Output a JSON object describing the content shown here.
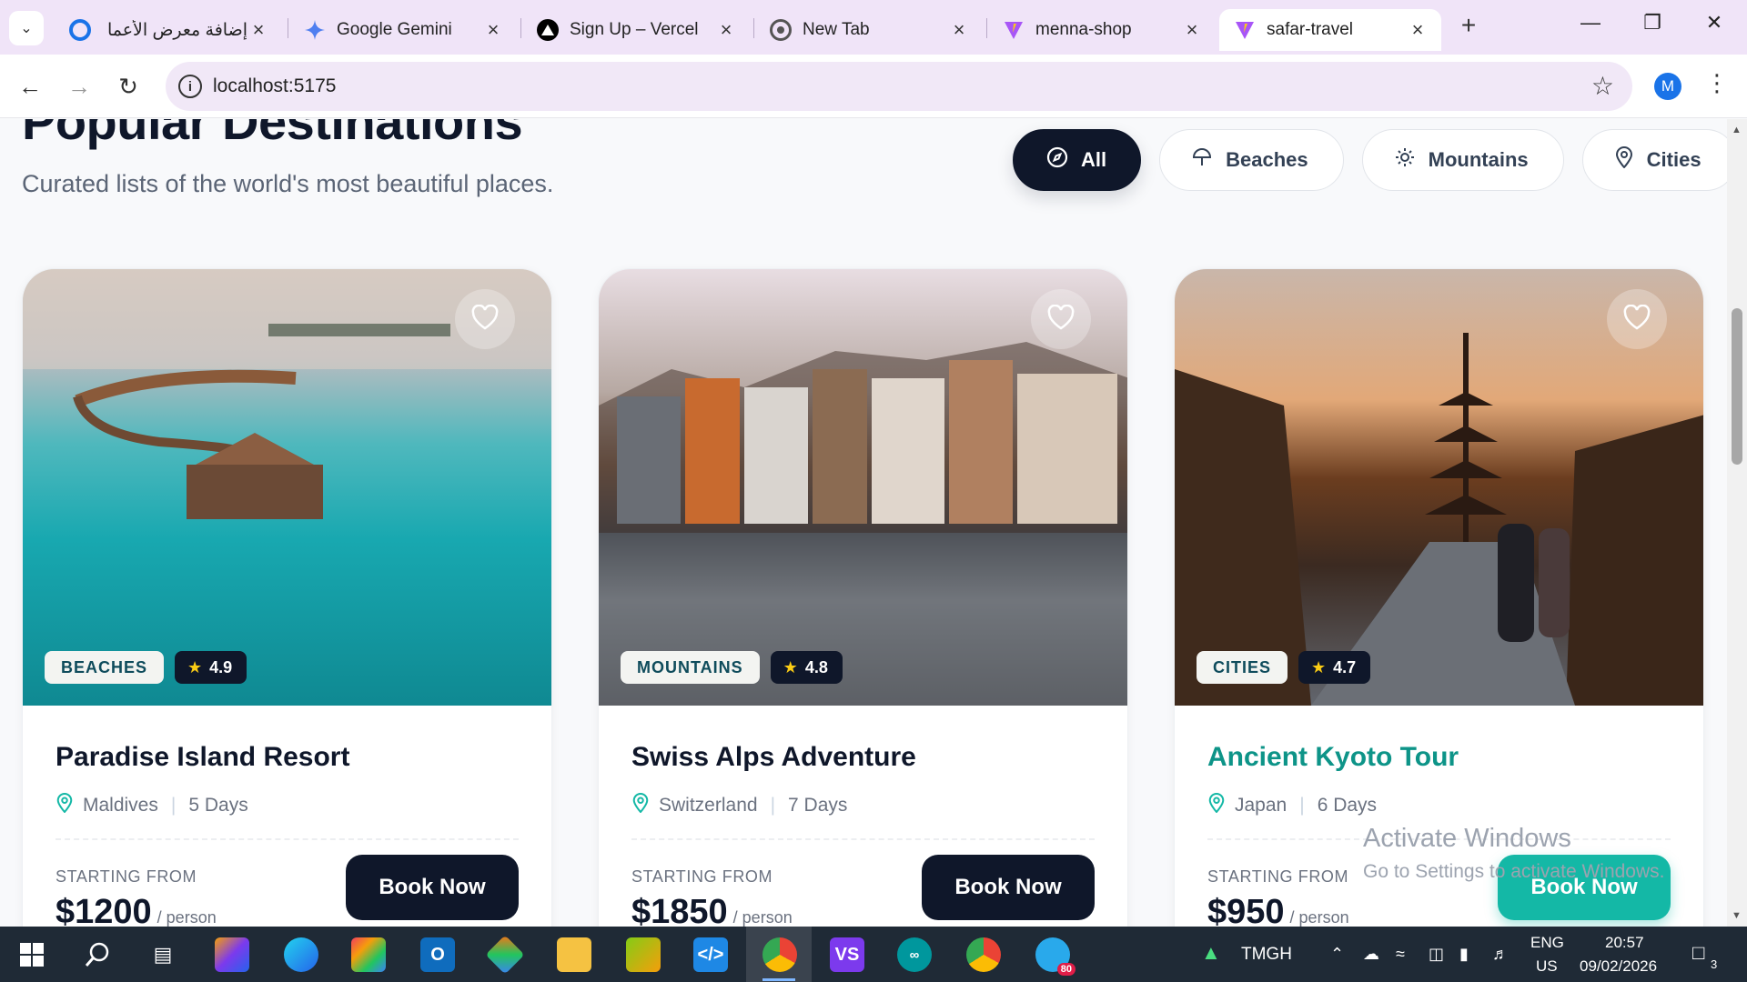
{
  "browser": {
    "tabs": [
      {
        "title": "إضافة معرض الأعما",
        "favicon": "web-icon",
        "favicon_color": "#1a73e8",
        "active": false
      },
      {
        "title": "Google Gemini",
        "favicon": "gemini-icon",
        "favicon_color": "#5b8def",
        "active": false
      },
      {
        "title": "Sign Up – Vercel",
        "favicon": "vercel-icon",
        "favicon_color": "#000000",
        "active": false
      },
      {
        "title": "New Tab",
        "favicon": "chrome-icon",
        "favicon_color": "#555555",
        "active": false
      },
      {
        "title": "menna-shop",
        "favicon": "vite-icon",
        "favicon_color": "#a855f7",
        "active": false
      },
      {
        "title": "safar-travel",
        "favicon": "vite-icon",
        "favicon_color": "#a855f7",
        "active": true
      }
    ],
    "url": "localhost:5175",
    "profile_initial": "M"
  },
  "page": {
    "title": "Popular Destinations",
    "subtitle": "Curated lists of the world's most beautiful places.",
    "filters": [
      {
        "label": "All",
        "icon": "compass-icon",
        "active": true
      },
      {
        "label": "Beaches",
        "icon": "umbrella-icon",
        "active": false
      },
      {
        "label": "Mountains",
        "icon": "sun-icon",
        "active": false
      },
      {
        "label": "Cities",
        "icon": "map-pin-icon",
        "active": false
      }
    ],
    "cards": [
      {
        "title": "Paradise Island Resort",
        "category": "BEACHES",
        "rating": "4.9",
        "location": "Maldives",
        "duration": "5 Days",
        "from_label": "STARTING FROM",
        "price": "$1200",
        "per": "/ person",
        "button": "Book Now"
      },
      {
        "title": "Swiss Alps Adventure",
        "category": "MOUNTAINS",
        "rating": "4.8",
        "location": "Switzerland",
        "duration": "7 Days",
        "from_label": "STARTING FROM",
        "price": "$1850",
        "per": "/ person",
        "button": "Book Now"
      },
      {
        "title": "Ancient Kyoto Tour",
        "category": "CITIES",
        "rating": "4.7",
        "location": "Japan",
        "duration": "6 Days",
        "from_label": "STARTING FROM",
        "price": "$950",
        "per": "/ person",
        "button": "Book Now"
      }
    ]
  },
  "watermark": {
    "line1": "Activate Windows",
    "line2": "Go to Settings to activate Windows."
  },
  "taskbar": {
    "weather": "TMGH",
    "language": "ENG",
    "region": "US",
    "time": "20:57",
    "date": "09/02/2026",
    "notifications": "3",
    "telegram_badge": "80"
  },
  "colors": {
    "accent_dark": "#0f172a",
    "accent_teal": "#14b8a6",
    "tab_strip": "#f0e4f8"
  }
}
